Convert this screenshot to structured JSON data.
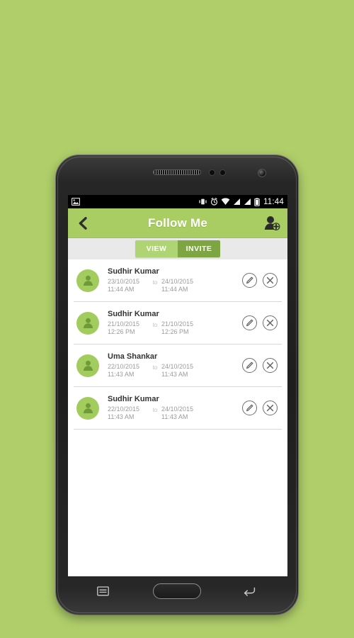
{
  "background_color": "#b0cf6a",
  "device": {
    "name": "android-phone",
    "bezel": {
      "speaker_icon": "speaker-grille",
      "sensor_icons": [
        "proximity-sensor",
        "light-sensor"
      ],
      "camera_icon": "front-camera",
      "home_button": "home-button",
      "menu_icon": "menu-icon",
      "back_icon": "back-arrow-icon"
    }
  },
  "status_bar": {
    "background": "#000000",
    "left_icons": [
      "image-icon"
    ],
    "right_icons": [
      "vibrate-icon",
      "alarm-icon",
      "wifi-icon",
      "signal-icon",
      "signal-icon-2",
      "battery-icon"
    ],
    "time": "11:44"
  },
  "action_bar": {
    "background": "#a9cd62",
    "back_icon": "back-chevron-icon",
    "title": "Follow Me",
    "add_user_icon": "add-user-icon"
  },
  "tabs": {
    "background": "#e9e9e9",
    "active_color": "#7da643",
    "inactive_color": "#aed473",
    "items": [
      {
        "label": "VIEW",
        "active": false
      },
      {
        "label": "INVITE",
        "active": true
      }
    ]
  },
  "list": {
    "separator_label": "to",
    "avatar_icon": "person-avatar-icon",
    "edit_icon": "edit-pencil-icon",
    "delete_icon": "delete-x-icon",
    "rows": [
      {
        "name": "Sudhir Kumar",
        "start_date": "23/10/2015",
        "start_time": "11:44 AM",
        "separator": "to",
        "end_date": "24/10/2015",
        "end_time": "11:44 AM"
      },
      {
        "name": "Sudhir Kumar",
        "start_date": "21/10/2015",
        "start_time": "12:26 PM",
        "separator": "to",
        "end_date": "21/10/2015",
        "end_time": "12:26 PM"
      },
      {
        "name": "Uma Shankar",
        "start_date": "22/10/2015",
        "start_time": "11:43 AM",
        "separator": "to",
        "end_date": "24/10/2015",
        "end_time": "11:43 AM"
      },
      {
        "name": "Sudhir Kumar",
        "start_date": "22/10/2015",
        "start_time": "11:43 AM",
        "separator": "to",
        "end_date": "24/10/2015",
        "end_time": "11:43 AM"
      }
    ]
  }
}
